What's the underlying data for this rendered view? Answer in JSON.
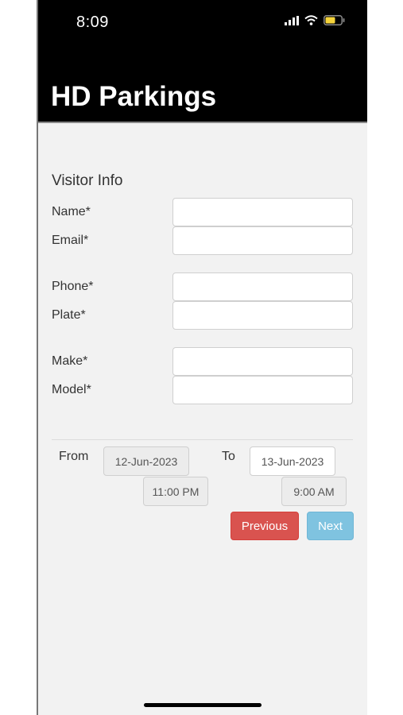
{
  "status_bar": {
    "time": "8:09",
    "icons": [
      "cellular-signal-icon",
      "wifi-icon",
      "battery-icon"
    ],
    "battery_color": "#f5d33a"
  },
  "header": {
    "title": "HD Parkings",
    "background": "#000000"
  },
  "form": {
    "section_title": "Visitor Info",
    "fields": [
      {
        "label": "Name*",
        "value": ""
      },
      {
        "label": "Email*",
        "value": ""
      },
      {
        "label": "Phone*",
        "value": ""
      },
      {
        "label": "Plate*",
        "value": ""
      },
      {
        "label": "Make*",
        "value": ""
      },
      {
        "label": "Model*",
        "value": ""
      }
    ]
  },
  "schedule": {
    "from_label": "From",
    "from_date": "12-Jun-2023",
    "from_time": "11:00 PM",
    "to_label": "To",
    "to_date": "13-Jun-2023",
    "to_time": "9:00 AM"
  },
  "buttons": {
    "previous": "Previous",
    "next": "Next",
    "previous_color": "#d9534f",
    "next_color": "#7fc3e0"
  }
}
